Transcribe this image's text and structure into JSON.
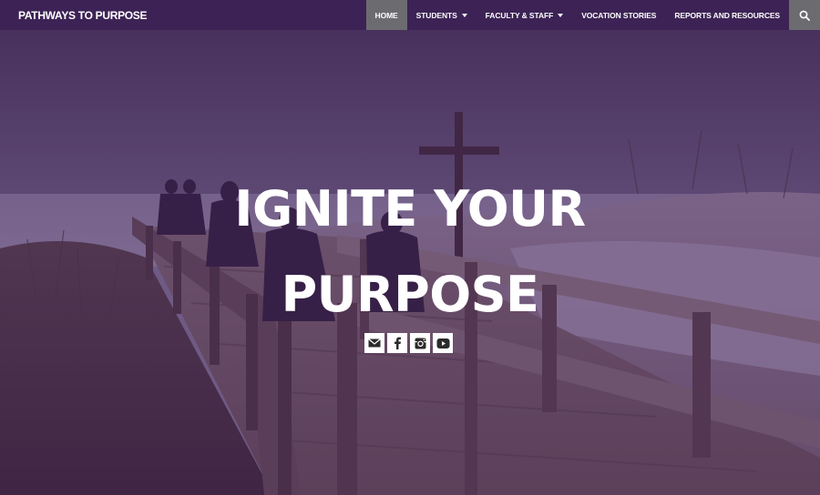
{
  "site": {
    "title": "PATHWAYS TO PURPOSE"
  },
  "nav": {
    "items": [
      {
        "label": "HOME",
        "active": true,
        "dropdown": false
      },
      {
        "label": "STUDENTS",
        "active": false,
        "dropdown": true
      },
      {
        "label": "FACULTY & STAFF",
        "active": false,
        "dropdown": true
      },
      {
        "label": "VOCATION STORIES",
        "active": false,
        "dropdown": false
      },
      {
        "label": "REPORTS AND RESOURCES",
        "active": false,
        "dropdown": false
      }
    ],
    "search_icon": "search-icon"
  },
  "hero": {
    "title_line1": "IGNITE YOUR",
    "title_line2": "PURPOSE",
    "social": [
      "email-icon",
      "facebook-icon",
      "instagram-icon",
      "youtube-icon"
    ]
  },
  "colors": {
    "nav_bg": "#3d2355",
    "nav_active": "#6b6b70",
    "overlay": "#461e64"
  }
}
